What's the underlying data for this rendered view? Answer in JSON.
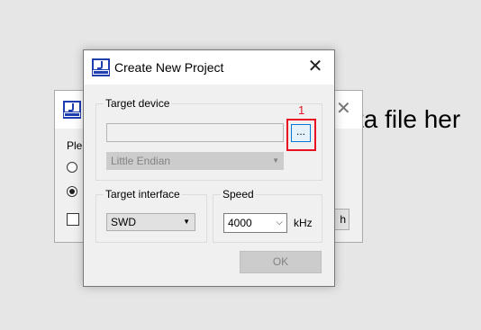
{
  "background": {
    "text": "ta file her",
    "dialog": {
      "label": "Ple",
      "button_label": "h"
    }
  },
  "dialog": {
    "title": "Create New Project",
    "close_glyph": "✕",
    "target_device": {
      "group_label": "Target device",
      "device_value": "",
      "browse_label": "...",
      "endian_value": "Little Endian",
      "annotation_number": "1"
    },
    "target_interface": {
      "group_label": "Target interface",
      "value": "SWD"
    },
    "speed": {
      "group_label": "Speed",
      "value": "4000",
      "unit": "kHz"
    },
    "ok_label": "OK"
  },
  "colors": {
    "highlight": "#e81123",
    "logo_blue": "#1f3fb0"
  },
  "icons": {
    "app_logo": "jflash-logo-icon",
    "close": "close-icon",
    "dropdown": "chevron-down-icon"
  }
}
